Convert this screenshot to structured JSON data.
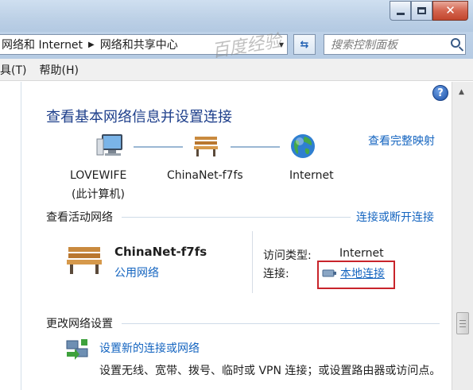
{
  "address_bar": {
    "crumbs": [
      "网络和 Internet",
      "网络和共享中心"
    ]
  },
  "search": {
    "placeholder": "搜索控制面板"
  },
  "menu": {
    "items": [
      "具(T)",
      "帮助(H)"
    ]
  },
  "page": {
    "title": "查看基本网络信息并设置连接",
    "full_map_link": "查看完整映射",
    "nodes": [
      {
        "label": "LOVEWIFE",
        "sublabel": "(此计算机)"
      },
      {
        "label": "ChinaNet-f7fs"
      },
      {
        "label": "Internet"
      }
    ],
    "active_section": {
      "title": "查看活动网络",
      "link": "连接或断开连接",
      "network_name": "ChinaNet-f7fs",
      "network_category": "公用网络",
      "access_type_label": "访问类型:",
      "access_type_value": "Internet",
      "connection_label": "连接:",
      "connection_value": "本地连接"
    },
    "change_section": {
      "title": "更改网络设置",
      "task_link": "设置新的连接或网络",
      "task_desc": "设置无线、宽带、拨号、临时或 VPN 连接；或设置路由器或访问点。"
    }
  },
  "watermark": "百度经验",
  "colors": {
    "accent_link": "#1565c0",
    "title_blue": "#1e3f8b",
    "highlight_box": "#c8242b"
  }
}
